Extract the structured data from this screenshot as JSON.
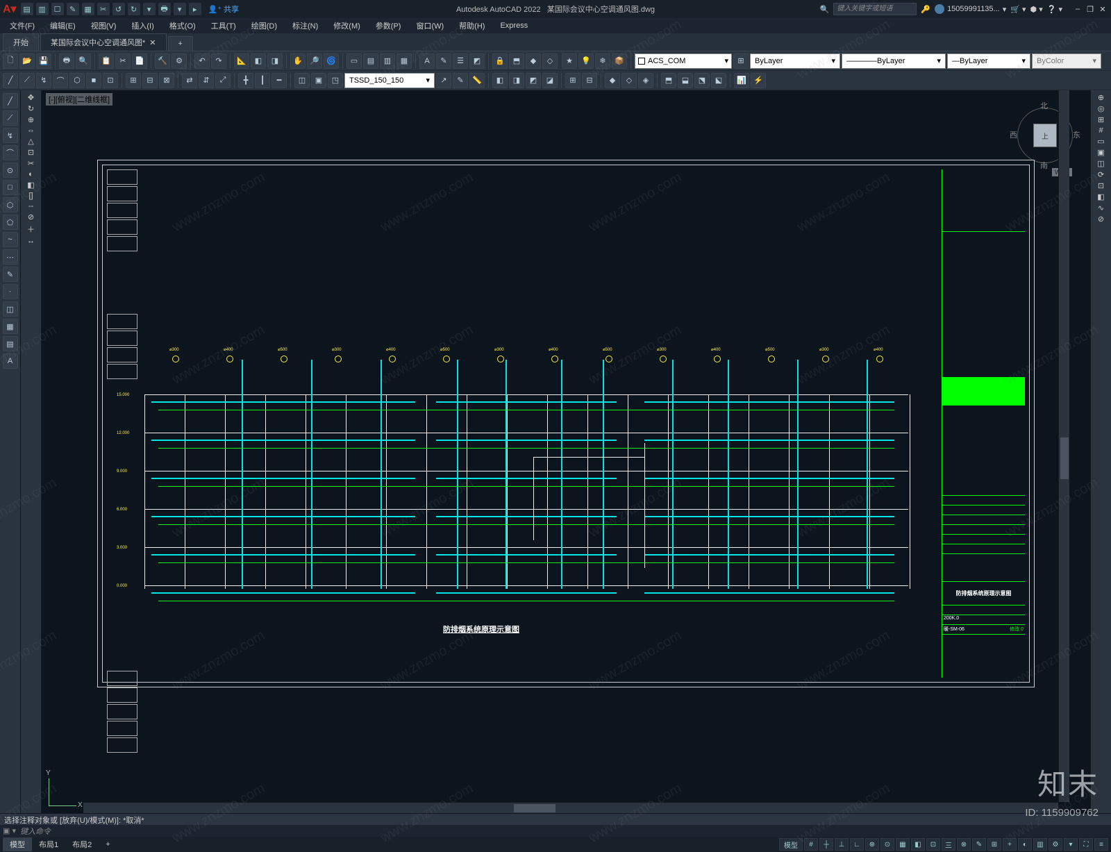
{
  "app": {
    "name": "Autodesk AutoCAD 2022",
    "file": "某国际会议中心空调通风图.dwg",
    "share": "共享",
    "search_placeholder": "键入关键字或短语",
    "user": "15059991135...",
    "window": {
      "min": "–",
      "restore": "❐",
      "close": "✕"
    }
  },
  "menus": [
    "文件(F)",
    "编辑(E)",
    "视图(V)",
    "插入(I)",
    "格式(O)",
    "工具(T)",
    "绘图(D)",
    "标注(N)",
    "修改(M)",
    "参数(P)",
    "窗口(W)",
    "帮助(H)",
    "Express"
  ],
  "doc_tabs": {
    "start": "开始",
    "file": "某国际会议中心空调通风图*",
    "plus": "+"
  },
  "ribbon": {
    "layer_dd": "ACS_COM",
    "bylayer1": "ByLayer",
    "bylayer2": "ByLayer",
    "bylayer3": "ByLayer",
    "bycolor": "ByColor",
    "tssd": "TSSD_150_150"
  },
  "viewport_label": "[-][俯视][二维线框]",
  "viewcube": {
    "top": "上",
    "n": "北",
    "s": "南",
    "e": "东",
    "w": "西",
    "wcs": "WCS"
  },
  "drawing": {
    "title": "防排烟系统原理示意图",
    "titleblock_title": "防排烟系统原理示意图",
    "tb_scale": "200K.0",
    "tb_code": "暖-SM-06",
    "tb_rev": "修改 0"
  },
  "ucs": {
    "x": "X",
    "y": "Y"
  },
  "cmd": {
    "history": "选择注释对象或 [放弃(U)/模式(M)]: *取消*",
    "prompt": "键入命令",
    "handle": "▣ ▾"
  },
  "status": {
    "tabs": [
      "模型",
      "布局1",
      "布局2"
    ],
    "right_label": "模型"
  },
  "watermark": {
    "brand": "知末",
    "id": "ID: 1159909762",
    "url": "www.znzmo.com"
  },
  "qat_icons": [
    "▤",
    "▥",
    "☐",
    "✎",
    "▦",
    "✂",
    "↺",
    "↻",
    "▾",
    "🖶",
    "▾",
    "▸"
  ],
  "ribbon_row1_icons": [
    "🗋",
    "📂",
    "💾",
    "|",
    "🖶",
    "🔍",
    "|",
    "📋",
    "✂",
    "📄",
    "|",
    "🔨",
    "⚙",
    "|",
    "↶",
    "↷",
    "|",
    "📐",
    "◧",
    "◨",
    "|",
    "✋",
    "🔎",
    "🌀",
    "|",
    "▭",
    "▤",
    "▥",
    "▦",
    "|",
    "A",
    "✎",
    "☰",
    "◩",
    "|",
    "🔒",
    "⬒",
    "◆",
    "◇"
  ],
  "ribbon_row1b_icons": [
    "★",
    "💡",
    "❄",
    "📦",
    "|"
  ],
  "ribbon_row2_icons": [
    "╱",
    "⟋",
    "↯",
    "⌒",
    "⬡",
    "■",
    "⊡",
    "|",
    "⊞",
    "⊟",
    "⊠",
    "|",
    "⇄",
    "⇵",
    "⤢",
    "|",
    "╋",
    "┃",
    "━",
    "|",
    "◫",
    "▣",
    "◳"
  ],
  "ribbon_row2b_icons": [
    "↗",
    "✎",
    "📏",
    "|",
    "◧",
    "◨",
    "◩",
    "◪",
    "|",
    "⊞",
    "⊟",
    "|",
    "◆",
    "◇",
    "◈",
    "|",
    "⬒",
    "⬓",
    "⬔",
    "⬕",
    "|",
    "📊",
    "⚡"
  ],
  "left_tools": [
    "╱",
    "⟋",
    "↯",
    "⌒",
    "⊙",
    "□",
    "⬡",
    "⬠",
    "~",
    "⋯",
    "✎",
    "·",
    "◫",
    "▦",
    "▤",
    "A"
  ],
  "left_tools2": [
    "✥",
    "↻",
    "⊕",
    "⇔",
    "△",
    "⊡",
    "✂",
    "◐",
    "◧",
    "[]",
    "--",
    "⊘",
    "＋",
    "↔"
  ],
  "right_tools": [
    "⊕",
    "◎",
    "⊞",
    "#",
    "▭",
    "▣",
    "◫",
    "⟳",
    "⊡",
    "◧",
    "∿",
    "⊘"
  ],
  "status_icons": [
    "#",
    "┼",
    "⊥",
    "∟",
    "⊕",
    "⊙",
    "▦",
    "◧",
    "⊡",
    "三",
    "⊗",
    "✎",
    "⊞",
    "+",
    "◐",
    "▥",
    "⚙",
    "▾",
    "⛶",
    "≡"
  ]
}
